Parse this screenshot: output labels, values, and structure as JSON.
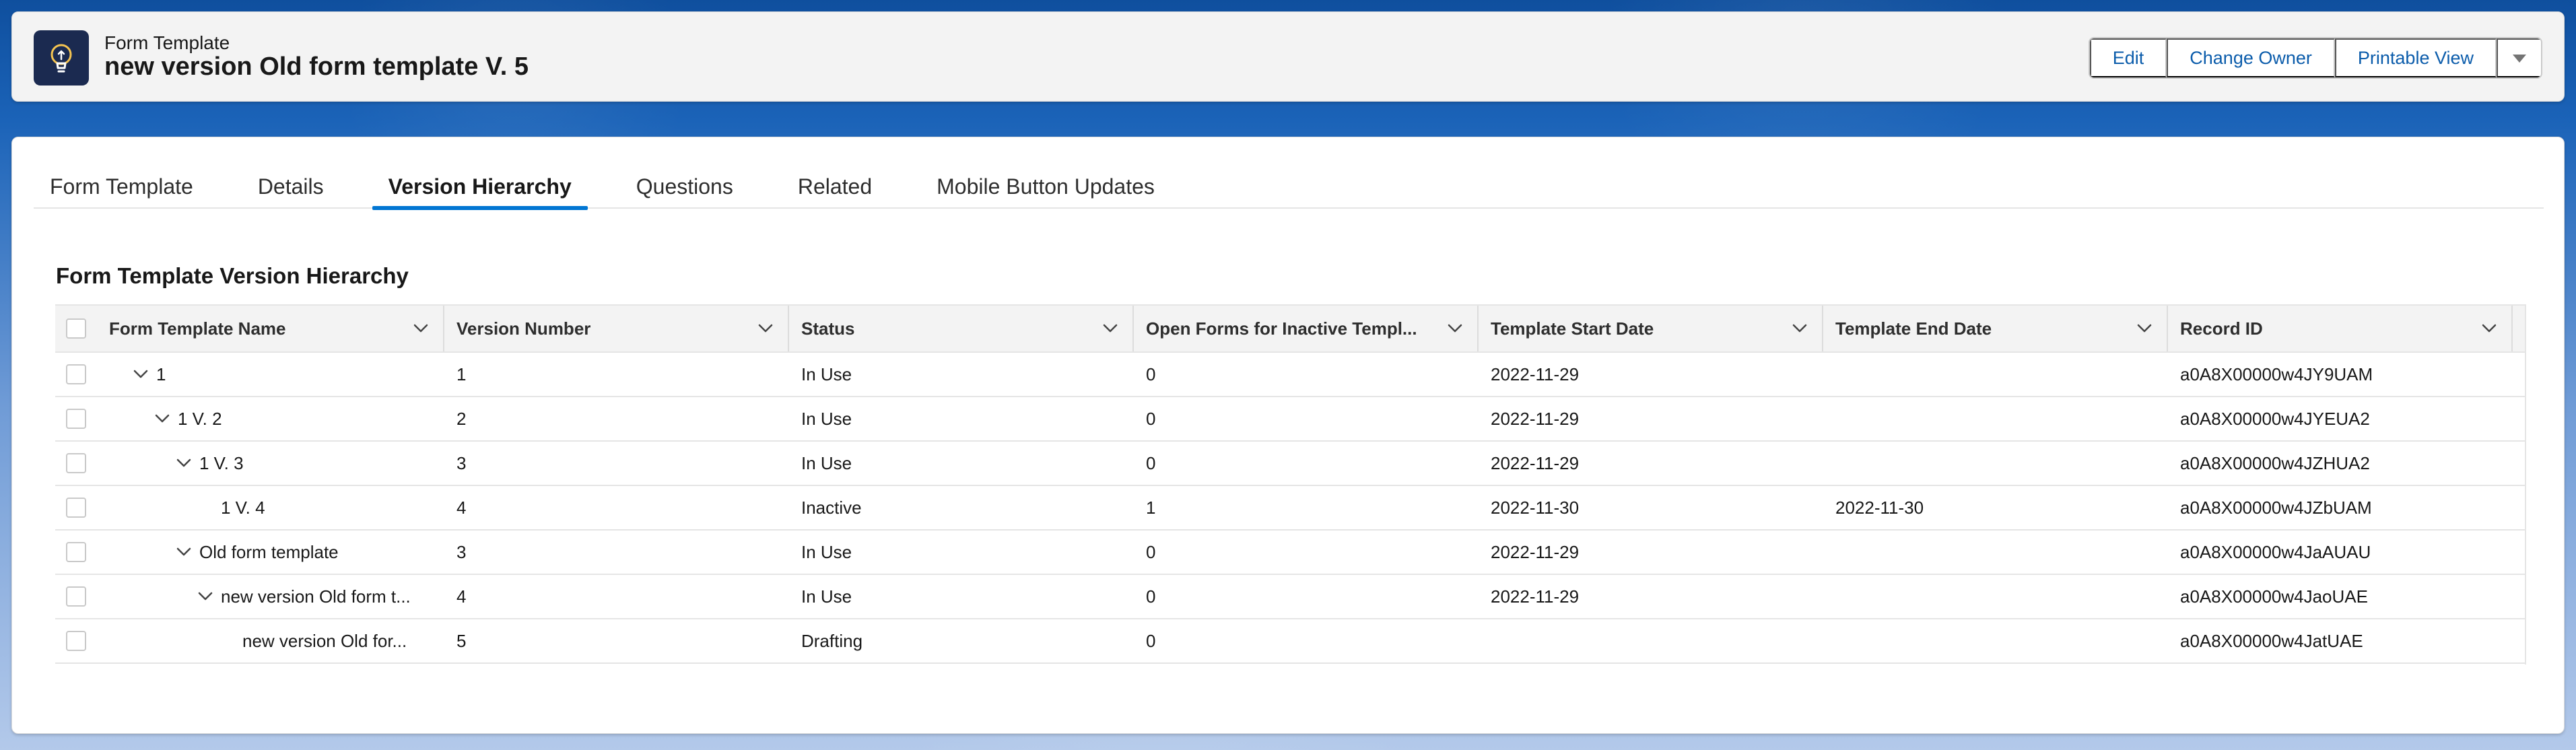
{
  "header": {
    "object_label": "Form Template",
    "record_title": "new version Old form template V. 5",
    "actions": {
      "edit": "Edit",
      "change_owner": "Change Owner",
      "printable_view": "Printable View"
    }
  },
  "tabs": [
    {
      "label": "Form Template",
      "active": false
    },
    {
      "label": "Details",
      "active": false
    },
    {
      "label": "Version Hierarchy",
      "active": true
    },
    {
      "label": "Questions",
      "active": false
    },
    {
      "label": "Related",
      "active": false
    },
    {
      "label": "Mobile Button Updates",
      "active": false
    }
  ],
  "section": {
    "title": "Form Template Version Hierarchy"
  },
  "table": {
    "columns": [
      "Form Template Name",
      "Version Number",
      "Status",
      "Open Forms for Inactive Templ...",
      "Template Start Date",
      "Template End Date",
      "Record ID"
    ],
    "rows": [
      {
        "name": "1",
        "level": 1,
        "expanded": true,
        "version": "1",
        "status": "In Use",
        "open_forms": "0",
        "start": "2022-11-29",
        "end": "",
        "record_id": "a0A8X00000w4JY9UAM"
      },
      {
        "name": "1 V. 2",
        "level": 2,
        "expanded": true,
        "version": "2",
        "status": "In Use",
        "open_forms": "0",
        "start": "2022-11-29",
        "end": "",
        "record_id": "a0A8X00000w4JYEUA2"
      },
      {
        "name": "1 V. 3",
        "level": 3,
        "expanded": true,
        "version": "3",
        "status": "In Use",
        "open_forms": "0",
        "start": "2022-11-29",
        "end": "",
        "record_id": "a0A8X00000w4JZHUA2"
      },
      {
        "name": "1 V. 4",
        "level": 4,
        "expanded": null,
        "version": "4",
        "status": "Inactive",
        "open_forms": "1",
        "start": "2022-11-30",
        "end": "2022-11-30",
        "record_id": "a0A8X00000w4JZbUAM"
      },
      {
        "name": "Old form template",
        "level": 3,
        "expanded": true,
        "version": "3",
        "status": "In Use",
        "open_forms": "0",
        "start": "2022-11-29",
        "end": "",
        "record_id": "a0A8X00000w4JaAUAU"
      },
      {
        "name": "new version Old form t...",
        "level": 4,
        "expanded": true,
        "version": "4",
        "status": "In Use",
        "open_forms": "0",
        "start": "2022-11-29",
        "end": "",
        "record_id": "a0A8X00000w4JaoUAE"
      },
      {
        "name": "new version Old for...",
        "level": 5,
        "expanded": null,
        "version": "5",
        "status": "Drafting",
        "open_forms": "0",
        "start": "",
        "end": "",
        "record_id": "a0A8X00000w4JatUAE"
      }
    ]
  },
  "colors": {
    "accent": "#0176d3",
    "link": "#0b5cab",
    "app_icon_bg": "#1b2a50",
    "app_icon_glyph": "#f5c451"
  },
  "icons": {
    "app": "lightbulb-icon",
    "more": "caret-down-icon",
    "column_menu": "chevron-down-icon",
    "tree_toggle": "chevron-down-icon"
  }
}
